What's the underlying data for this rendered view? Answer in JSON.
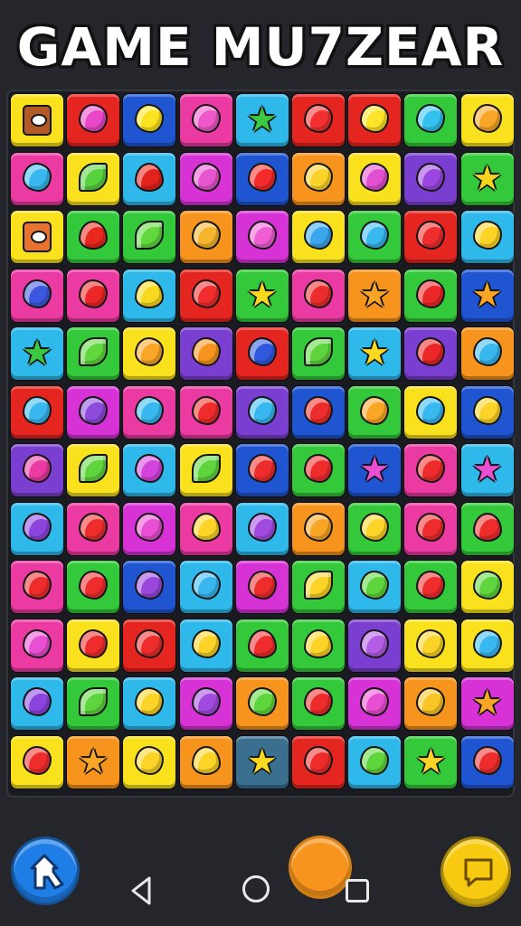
{
  "title": "GAME MU7ZEAR",
  "board": {
    "columns": 9,
    "rows": 12,
    "colors": {
      "yellow": "#f9e21d",
      "red": "#e5251f",
      "blue": "#1f55d1",
      "pink": "#ec3aa3",
      "cyan": "#2fb8ea",
      "green": "#33c93a",
      "orange": "#f6941d",
      "purple": "#7a3fd0",
      "magenta": "#d632d6",
      "teal": "#3a6f8f"
    },
    "tiles": [
      [
        [
          "yellow",
          "box",
          "#b45a26"
        ],
        [
          "red",
          "gem",
          "#e946c8"
        ],
        [
          "blue",
          "gem",
          "#fbe31f"
        ],
        [
          "pink",
          "gem",
          "#ee58c8"
        ],
        [
          "cyan",
          "star",
          "#3bc944"
        ],
        [
          "red",
          "gem",
          "#f33030"
        ],
        [
          "red",
          "gem",
          "#fde428"
        ],
        [
          "green",
          "gem",
          "#33c3ee"
        ],
        [
          "yellow",
          "gem",
          "#f9a526"
        ]
      ],
      [
        [
          "pink",
          "gem",
          "#39b8f0"
        ],
        [
          "yellow",
          "leaf",
          "#57d23e"
        ],
        [
          "cyan",
          "drop",
          "#e3221b"
        ],
        [
          "magenta",
          "gem",
          "#e755cf"
        ],
        [
          "blue",
          "gem",
          "#f22a2a"
        ],
        [
          "orange",
          "gem",
          "#fbd22a"
        ],
        [
          "yellow",
          "gem",
          "#e24fd0"
        ],
        [
          "purple",
          "gem",
          "#9c46e0"
        ],
        [
          "green",
          "star",
          "#f6d51f"
        ]
      ],
      [
        [
          "yellow",
          "box",
          "#e8732f"
        ],
        [
          "green",
          "drop",
          "#e8281d"
        ],
        [
          "green",
          "leaf",
          "#60d83e"
        ],
        [
          "orange",
          "gem",
          "#f6b52c"
        ],
        [
          "magenta",
          "gem",
          "#f05ed4"
        ],
        [
          "yellow",
          "gem",
          "#3aa6ec"
        ],
        [
          "green",
          "gem",
          "#39b8f0"
        ],
        [
          "red",
          "gem",
          "#f02d2d"
        ],
        [
          "cyan",
          "gem",
          "#fbd427"
        ]
      ],
      [
        [
          "pink",
          "gem",
          "#3d58e0"
        ],
        [
          "pink",
          "gem",
          "#ec2727"
        ],
        [
          "cyan",
          "drop",
          "#f9d91f"
        ],
        [
          "red",
          "gem",
          "#f12d2d"
        ],
        [
          "green",
          "star",
          "#f9d91f"
        ],
        [
          "pink",
          "gem",
          "#ec2d2d"
        ],
        [
          "orange",
          "star",
          "#f9a526"
        ],
        [
          "green",
          "gem",
          "#ec2727"
        ],
        [
          "blue",
          "star",
          "#f9a526"
        ]
      ],
      [
        [
          "cyan",
          "star",
          "#3bc944"
        ],
        [
          "green",
          "leaf",
          "#61d83e"
        ],
        [
          "yellow",
          "gem",
          "#f9a526"
        ],
        [
          "purple",
          "gem",
          "#f6941d"
        ],
        [
          "red",
          "gem",
          "#2f58dc"
        ],
        [
          "green",
          "leaf",
          "#5fd53d"
        ],
        [
          "cyan",
          "star",
          "#f9d91f"
        ],
        [
          "purple",
          "gem",
          "#ec2727"
        ],
        [
          "orange",
          "gem",
          "#39b8f0"
        ]
      ],
      [
        [
          "red",
          "gem",
          "#39b8f0"
        ],
        [
          "magenta",
          "gem",
          "#8e49dd"
        ],
        [
          "pink",
          "gem",
          "#39b8f0"
        ],
        [
          "pink",
          "gem",
          "#ee2c2c"
        ],
        [
          "purple",
          "gem",
          "#39b8f0"
        ],
        [
          "blue",
          "gem",
          "#ee2c2c"
        ],
        [
          "green",
          "gem",
          "#f9a526"
        ],
        [
          "yellow",
          "gem",
          "#39b8f0"
        ],
        [
          "blue",
          "gem",
          "#fbd427"
        ]
      ],
      [
        [
          "purple",
          "gem",
          "#ec3aa3"
        ],
        [
          "yellow",
          "leaf",
          "#5fd53d"
        ],
        [
          "cyan",
          "gem",
          "#d344dc"
        ],
        [
          "yellow",
          "leaf",
          "#5fd53d"
        ],
        [
          "blue",
          "gem",
          "#ee2c2c"
        ],
        [
          "green",
          "gem",
          "#ee2c2c"
        ],
        [
          "blue",
          "star",
          "#e94fd2"
        ],
        [
          "pink",
          "gem",
          "#ee2c2c"
        ],
        [
          "cyan",
          "star",
          "#e94fd2"
        ]
      ],
      [
        [
          "cyan",
          "gem",
          "#8b45de"
        ],
        [
          "pink",
          "gem",
          "#ee2c2c"
        ],
        [
          "magenta",
          "gem",
          "#e94fd2"
        ],
        [
          "pink",
          "drop",
          "#fbd427"
        ],
        [
          "cyan",
          "gem",
          "#a14ae0"
        ],
        [
          "orange",
          "gem",
          "#f9a526"
        ],
        [
          "green",
          "gem",
          "#fbd427"
        ],
        [
          "pink",
          "gem",
          "#ee2c2c"
        ],
        [
          "green",
          "drop",
          "#ee2c2c"
        ]
      ],
      [
        [
          "pink",
          "gem",
          "#ee2c2c"
        ],
        [
          "green",
          "gem",
          "#ee2c2c"
        ],
        [
          "blue",
          "gem",
          "#9a47de"
        ],
        [
          "cyan",
          "gem",
          "#39b8f0"
        ],
        [
          "magenta",
          "gem",
          "#ee2c2c"
        ],
        [
          "green",
          "leaf",
          "#fbd427"
        ],
        [
          "cyan",
          "gem",
          "#5fd53d"
        ],
        [
          "green",
          "gem",
          "#ee2c2c"
        ],
        [
          "yellow",
          "gem",
          "#5fd53d"
        ]
      ],
      [
        [
          "pink",
          "gem",
          "#e94fd2"
        ],
        [
          "yellow",
          "gem",
          "#ee2c2c"
        ],
        [
          "red",
          "gem",
          "#ee2c2c"
        ],
        [
          "cyan",
          "gem",
          "#fbd427"
        ],
        [
          "green",
          "drop",
          "#ee2c2c"
        ],
        [
          "green",
          "drop",
          "#fbd427"
        ],
        [
          "purple",
          "gem",
          "#b35de6"
        ],
        [
          "yellow",
          "gem",
          "#fbd427"
        ],
        [
          "yellow",
          "gem",
          "#39b8f0"
        ]
      ],
      [
        [
          "cyan",
          "gem",
          "#8b45de"
        ],
        [
          "green",
          "leaf",
          "#5fd53d"
        ],
        [
          "cyan",
          "gem",
          "#fbd427"
        ],
        [
          "magenta",
          "gem",
          "#a14ae0"
        ],
        [
          "orange",
          "gem",
          "#5fd53d"
        ],
        [
          "green",
          "gem",
          "#ee2c2c"
        ],
        [
          "magenta",
          "gem",
          "#e94fd2"
        ],
        [
          "orange",
          "gem",
          "#f9c526"
        ],
        [
          "magenta",
          "star",
          "#f9a526"
        ]
      ],
      [
        [
          "yellow",
          "gem",
          "#ee2c2c"
        ],
        [
          "orange",
          "star",
          "#f9a526"
        ],
        [
          "yellow",
          "gem",
          "#fbd427"
        ],
        [
          "orange",
          "drop",
          "#fbd427"
        ],
        [
          "teal",
          "star",
          "#f9d91f"
        ],
        [
          "red",
          "gem",
          "#ee2c2c"
        ],
        [
          "cyan",
          "gem",
          "#5fd53d"
        ],
        [
          "green",
          "star",
          "#fbd427"
        ],
        [
          "blue",
          "gem",
          "#ee2c2c"
        ]
      ]
    ]
  },
  "buttons": {
    "left": {
      "icon": "arrow-icon"
    },
    "center": {
      "icon": "orange-orb-icon"
    },
    "right": {
      "icon": "chat-icon"
    }
  },
  "navbar": {
    "back": "back-icon",
    "home": "home-icon",
    "recents": "recents-icon"
  }
}
